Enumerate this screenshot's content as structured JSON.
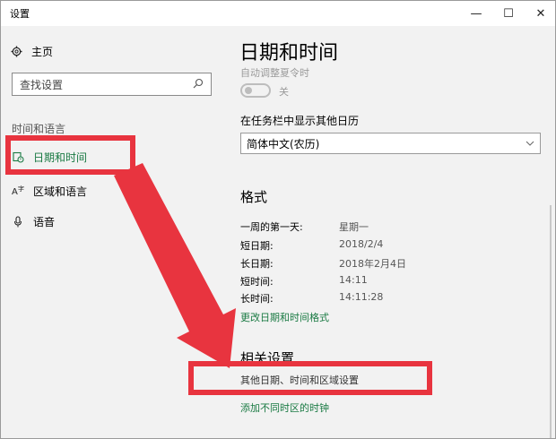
{
  "window": {
    "title": "设置",
    "minimize_glyph": "—",
    "maximize_glyph": "☐",
    "close_glyph": "✕"
  },
  "sidebar": {
    "home_label": "主页",
    "search_placeholder": "查找设置",
    "section_label": "时间和语言",
    "items": [
      {
        "label": "日期和时间",
        "icon": "calendar-clock-icon"
      },
      {
        "label": "区域和语言",
        "icon": "language-icon"
      },
      {
        "label": "语音",
        "icon": "microphone-icon"
      }
    ]
  },
  "main": {
    "title": "日期和时间",
    "auto_dst_label": "自动调整夏令时",
    "auto_dst_state": "关",
    "calendar_label": "在任务栏中显示其他日历",
    "calendar_value": "简体中文(农历)",
    "format_title": "格式",
    "format_rows": [
      {
        "label": "一周的第一天:",
        "value": "星期一"
      },
      {
        "label": "短日期:",
        "value": "2018/2/4"
      },
      {
        "label": "长日期:",
        "value": "2018年2月4日"
      },
      {
        "label": "短时间:",
        "value": "14:11"
      },
      {
        "label": "长时间:",
        "value": "14:11:28"
      }
    ],
    "format_link": "更改日期和时间格式",
    "related_title": "相关设置",
    "related_links": [
      "其他日期、时间和区域设置",
      "添加不同时区的时钟"
    ]
  },
  "colors": {
    "accent": "#1a7a43",
    "annotation": "#e8343f"
  }
}
